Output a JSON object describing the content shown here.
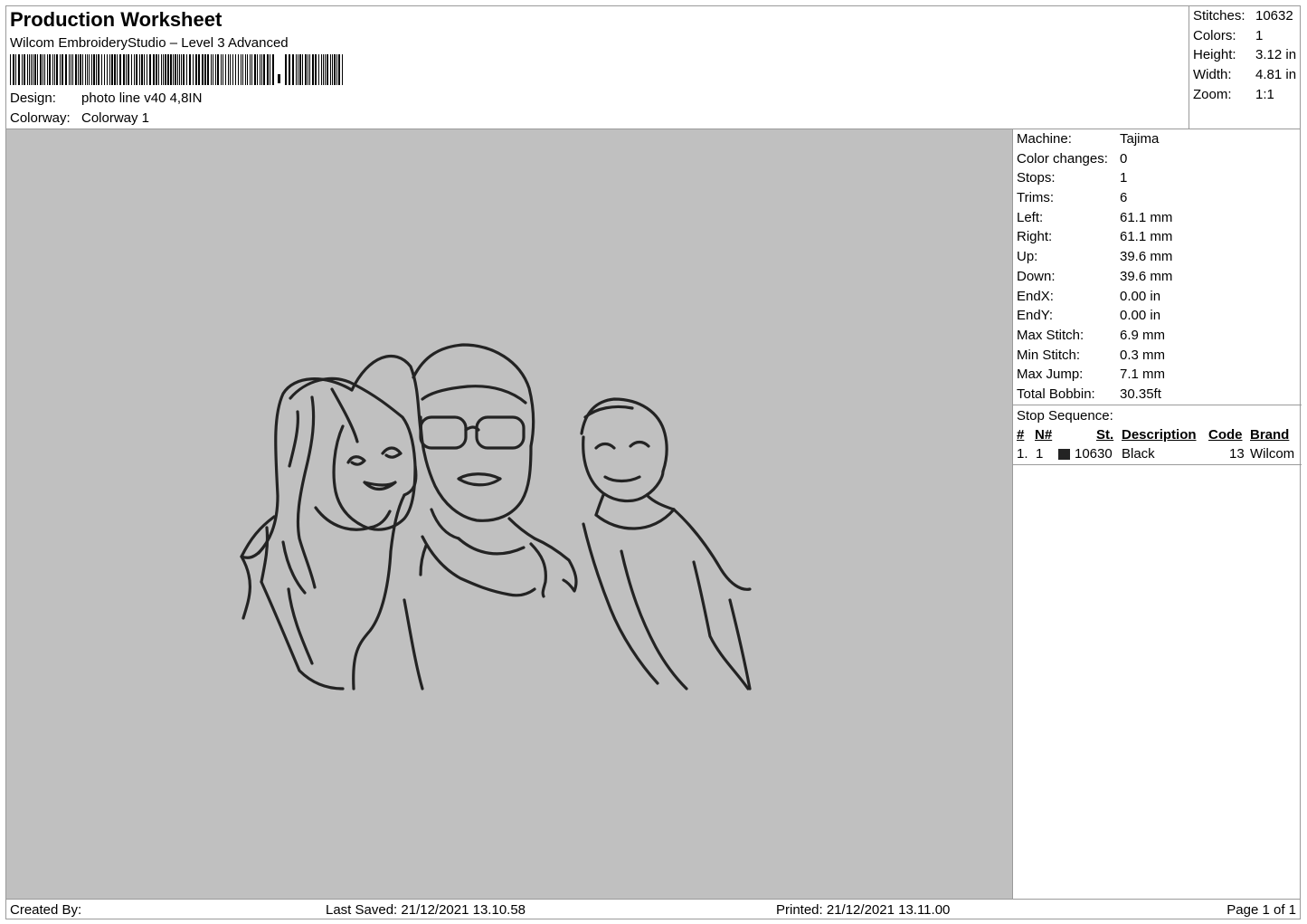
{
  "header": {
    "title": "Production Worksheet",
    "subtitle": "Wilcom EmbroideryStudio – Level 3 Advanced",
    "barcode_label": "barcode",
    "design_label": "Design:",
    "design_value": "photo line v40 4,8IN",
    "colorway_label": "Colorway:",
    "colorway_value": "Colorway 1"
  },
  "summary": [
    {
      "label": "Stitches:",
      "value": "10632"
    },
    {
      "label": "Colors:",
      "value": "1"
    },
    {
      "label": "Height:",
      "value": "3.12 in"
    },
    {
      "label": "Width:",
      "value": "4.81 in"
    },
    {
      "label": "Zoom:",
      "value": "1:1"
    }
  ],
  "machine_info": [
    {
      "label": "Machine:",
      "value": "Tajima"
    },
    {
      "label": "Color changes:",
      "value": "0"
    },
    {
      "label": "Stops:",
      "value": "1"
    },
    {
      "label": "Trims:",
      "value": "6"
    },
    {
      "label": "Left:",
      "value": "61.1 mm"
    },
    {
      "label": "Right:",
      "value": "61.1 mm"
    },
    {
      "label": "Up:",
      "value": "39.6 mm"
    },
    {
      "label": "Down:",
      "value": "39.6 mm"
    },
    {
      "label": "EndX:",
      "value": "0.00 in"
    },
    {
      "label": "EndY:",
      "value": "0.00 in"
    },
    {
      "label": "Max Stitch:",
      "value": "6.9 mm"
    },
    {
      "label": "Min Stitch:",
      "value": "0.3 mm"
    },
    {
      "label": "Max Jump:",
      "value": "7.1 mm"
    },
    {
      "label": "Total Bobbin:",
      "value": "30.35ft"
    }
  ],
  "stop_sequence": {
    "title": "Stop Sequence:",
    "headers": {
      "num": "#",
      "n": "N#",
      "st": "St.",
      "description": "Description",
      "code": "Code",
      "brand": "Brand"
    },
    "rows": [
      {
        "num": "1.",
        "n": "1",
        "st": "10630",
        "description": "Black",
        "code": "13",
        "brand": "Wilcom",
        "color": "#232323"
      }
    ]
  },
  "footer": {
    "created_by": "Created By:",
    "last_saved": "Last Saved: 21/12/2021 13.10.58",
    "printed": "Printed: 21/12/2021 13.11.00",
    "page": "Page 1 of 1"
  },
  "colors": {
    "canvas": "#c0c0c0",
    "thread": "#232323",
    "border": "#9a9a9a"
  }
}
